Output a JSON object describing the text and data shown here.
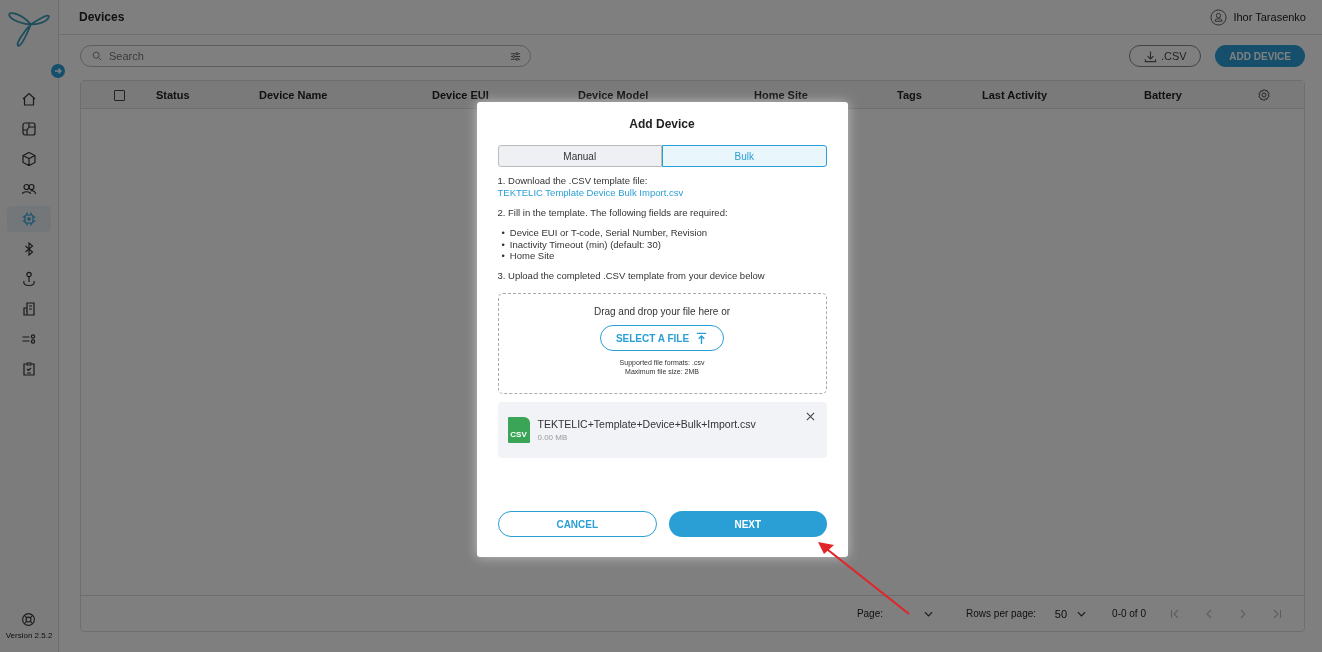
{
  "sidebar": {
    "items": [
      {
        "selected": false
      },
      {
        "selected": false
      },
      {
        "selected": false
      },
      {
        "selected": false
      },
      {
        "selected": true
      },
      {
        "selected": false
      },
      {
        "selected": false
      },
      {
        "selected": false
      },
      {
        "selected": false
      },
      {
        "selected": false
      }
    ],
    "version": "Version 2.5.2"
  },
  "header": {
    "title": "Devices",
    "user": "Ihor Tarasenko"
  },
  "toolbar": {
    "search_placeholder": "Search",
    "export_button": ".CSV",
    "add_button": "ADD DEVICE"
  },
  "table": {
    "select_all_checked": false,
    "columns": [
      "Status",
      "Device Name",
      "Device EUI",
      "Device Model",
      "Home Site",
      "Tags",
      "Last Activity",
      "Battery"
    ]
  },
  "pagination": {
    "page_label": "Page:",
    "rows_label": "Rows per page:",
    "rows_value": "50",
    "range": "0-0 of 0"
  },
  "modal": {
    "title": "Add Device",
    "tabs": [
      {
        "label": "Manual",
        "selected": false
      },
      {
        "label": "Bulk",
        "selected": true
      }
    ],
    "step1": "1. Download the .CSV template file:",
    "step1_link": "TEKTELIC Template Device Bulk Import.csv",
    "step2": "2. Fill in the template. The following fields are required:",
    "bullet": "•",
    "required_fields": [
      "Device EUI or T-code, Serial Number, Revision",
      "Inactivity Timeout (min) (default: 30)",
      "Home Site"
    ],
    "step3": "3. Upload the completed .CSV template from your device below",
    "dropzone": {
      "prompt": "Drag and drop your file here or",
      "button": "SELECT A FILE",
      "formats": "Supported file formats: .csv",
      "max_size": "Maximum file size: 2MB"
    },
    "file": {
      "name": "TEKTELIC+Template+Device+Bulk+Import.csv",
      "size": "0.00 MB",
      "type": "CSV"
    },
    "buttons": [
      {
        "label": "CANCEL",
        "kind": "outline"
      },
      {
        "label": "NEXT",
        "kind": "primary"
      }
    ]
  }
}
